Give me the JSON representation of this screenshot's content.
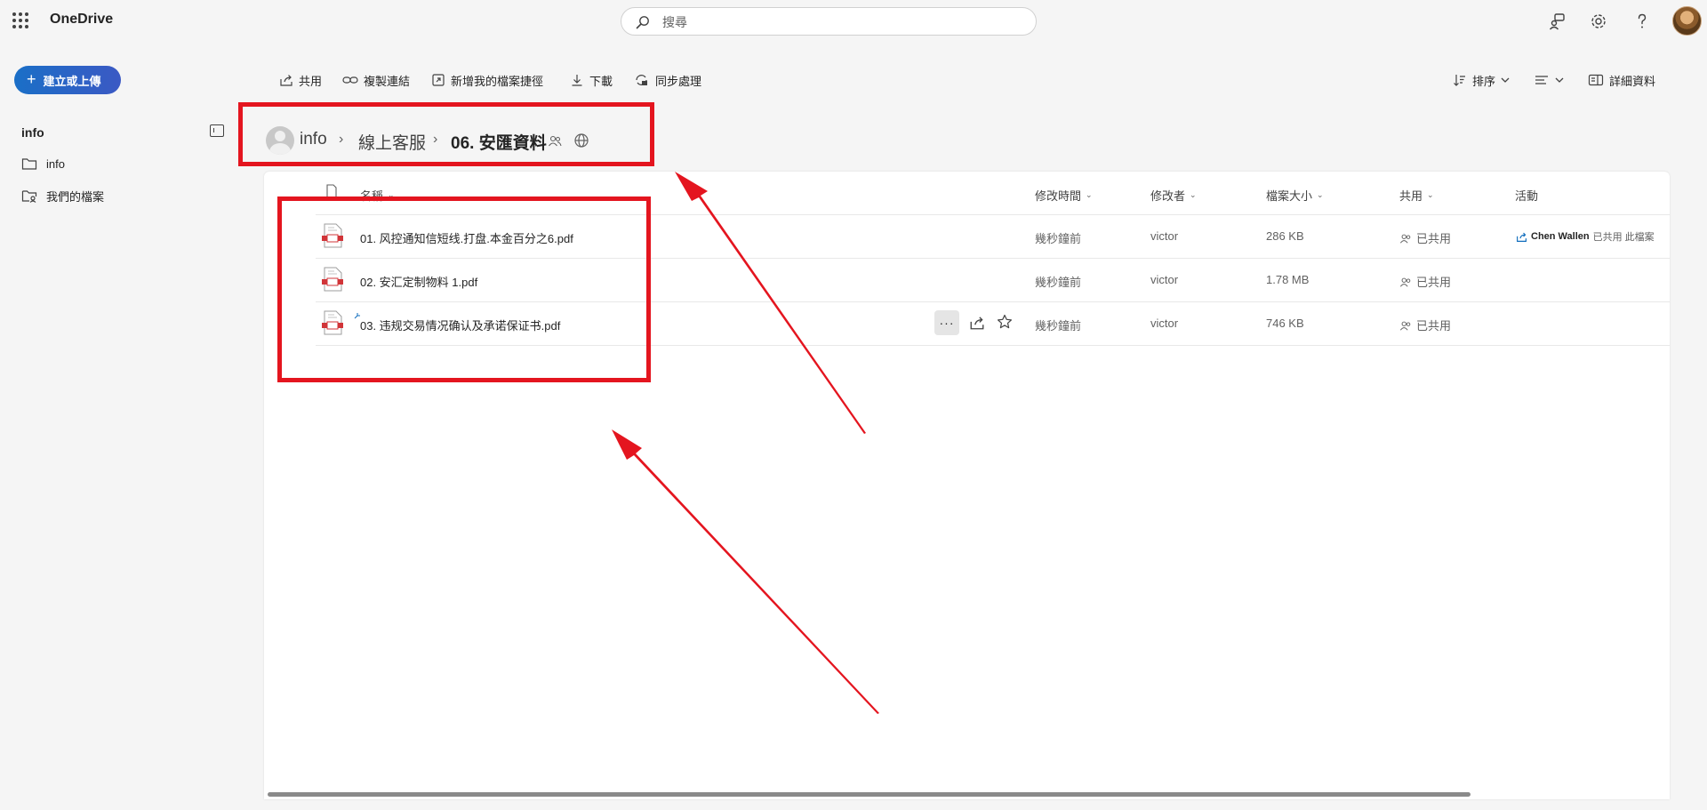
{
  "app": {
    "name": "OneDrive"
  },
  "search": {
    "placeholder": "搜尋"
  },
  "sidebar": {
    "create_label": "建立或上傳",
    "section_title": "info",
    "items": [
      {
        "label": "info",
        "icon": "folder-icon"
      },
      {
        "label": "我們的檔案",
        "icon": "shared-folder-icon"
      }
    ]
  },
  "commands": {
    "share": "共用",
    "copy_link": "複製連結",
    "add_shortcut": "新增我的檔案捷徑",
    "download": "下載",
    "sync": "同步處理",
    "sort": "排序",
    "details": "詳細資料"
  },
  "breadcrumb": {
    "root": "info",
    "middle": "線上客服",
    "current": "06. 安匯資料"
  },
  "table": {
    "headers": {
      "name": "名稱",
      "modified": "修改時間",
      "modified_by": "修改者",
      "size": "檔案大小",
      "sharing": "共用",
      "activity": "活動"
    },
    "rows": [
      {
        "name": "01. 风控通知信短线.打盘.本金百分之6.pdf",
        "modified": "幾秒鐘前",
        "modified_by": "victor",
        "size": "286 KB",
        "sharing": "已共用"
      },
      {
        "name": "02. 安汇定制物料 1.pdf",
        "modified": "幾秒鐘前",
        "modified_by": "victor",
        "size": "1.78 MB",
        "sharing": "已共用"
      },
      {
        "name": "03. 违规交易情况确认及承诺保证书.pdf",
        "modified": "幾秒鐘前",
        "modified_by": "victor",
        "size": "746 KB",
        "sharing": "已共用"
      }
    ],
    "activity_row1": {
      "user": "Chen Wallen",
      "text": "已共用 此檔案"
    }
  },
  "colors": {
    "accent": "#0f6cbd",
    "annotation": "#e4151f",
    "pdf": "#d13438"
  }
}
